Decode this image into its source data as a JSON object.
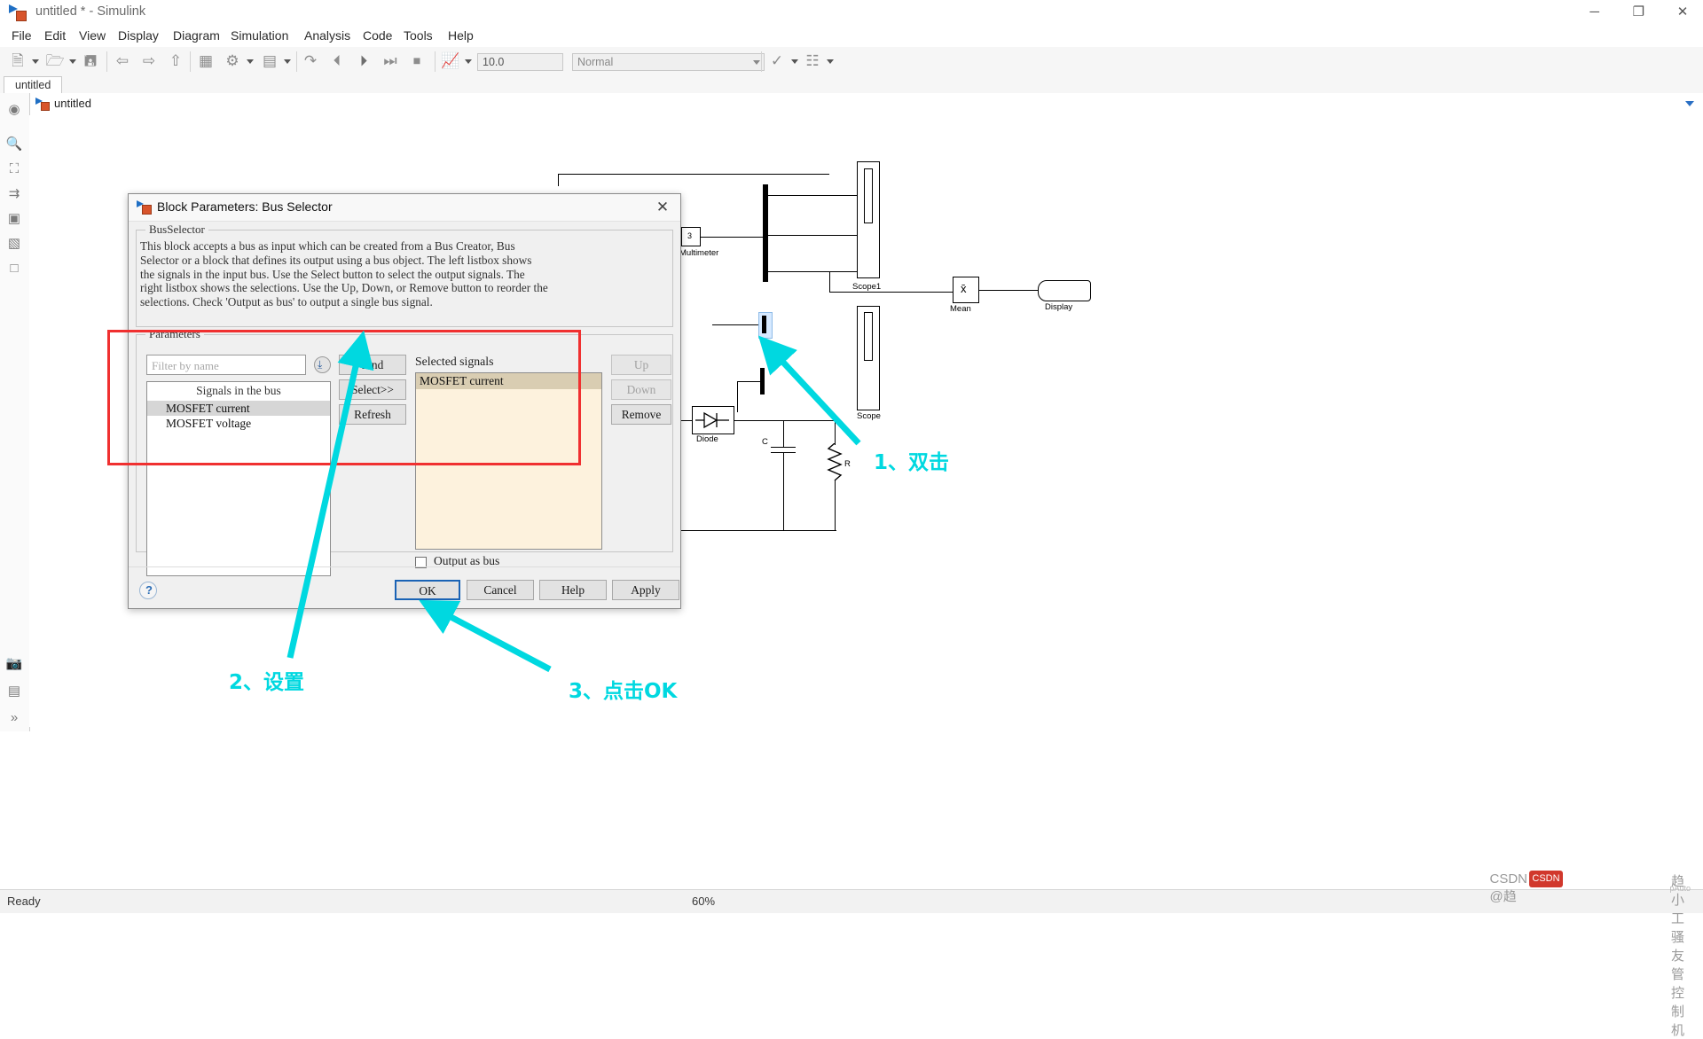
{
  "window": {
    "title": "untitled * - Simulink",
    "minimize": "─",
    "maximize": "❐",
    "close": "✕"
  },
  "menu": {
    "items": [
      "File",
      "Edit",
      "View",
      "Display",
      "Diagram",
      "Simulation",
      "Analysis",
      "Code",
      "Tools",
      "Help"
    ]
  },
  "toolbar": {
    "new_model_icon": "new-model-icon",
    "open_icon": "open-folder-icon",
    "save_icon": "save-icon",
    "back_icon": "back-arrow-icon",
    "forward_icon": "forward-arrow-icon",
    "up_icon": "up-arrow-icon",
    "library_icon": "library-browser-icon",
    "settings_icon": "model-configuration-icon",
    "model_explorer_icon": "model-explorer-icon",
    "update_icon": "update-model-icon",
    "build_icon": "build-model-icon",
    "run_icon": "run-icon",
    "step_icon": "step-forward-icon",
    "stop_icon": "stop-icon",
    "scope_icon": "simulation-data-inspector-icon",
    "stop_time_value": "10.0",
    "sim_mode_value": "Normal",
    "check_icon": "model-advisor-icon",
    "perspective_icon": "perspectives-icon"
  },
  "model_tab": {
    "label": "untitled"
  },
  "breadcrumb": {
    "label": "untitled"
  },
  "rail": {
    "items": [
      "navigate-icon",
      "zoom-icon",
      "fit-to-view-icon",
      "pan-icon",
      "annotation-icon",
      "image-icon",
      "area-icon",
      "camera-icon",
      "legend-icon",
      "expand-icon"
    ]
  },
  "canvas": {
    "blocks": [
      {
        "name": "Multimeter",
        "label": "Multimeter"
      },
      {
        "name": "Scope1",
        "label": "Scope1"
      },
      {
        "name": "Scope",
        "label": "Scope"
      },
      {
        "name": "Mean",
        "label": "Mean"
      },
      {
        "name": "Display",
        "label": "Display"
      },
      {
        "name": "Diode",
        "label": "Diode"
      },
      {
        "name": "C",
        "label": "C"
      },
      {
        "name": "R",
        "label": "R"
      }
    ],
    "multimeter_port": "3",
    "mean_symbol": "x̄"
  },
  "dialog": {
    "title": "Block Parameters: Bus Selector",
    "close_label": "✕",
    "group_bus": "BusSelector",
    "description": "This block accepts a bus as input which can be created from a Bus Creator, Bus\nSelector or a block that defines its output using a bus object. The left listbox shows\nthe signals in the input bus. Use the Select button to select the output signals. The\nright listbox shows the selections. Use the Up, Down, or Remove button to reorder the\nselections. Check 'Output as bus' to output a single bus signal.",
    "group_parameters": "Parameters",
    "filter_placeholder": "Filter by name",
    "filter_value": "",
    "filter_options_icon": "filter-options-icon",
    "signals_header": "Signals in the bus",
    "signals": [
      {
        "label": "MOSFET current",
        "selected": true
      },
      {
        "label": "MOSFET voltage",
        "selected": false
      }
    ],
    "find_label": "Find",
    "select_label": "Select>>",
    "refresh_label": "Refresh",
    "selected_signals_label": "Selected signals",
    "selected_signals": [
      {
        "label": "MOSFET current",
        "selected": true
      }
    ],
    "up_label": "Up",
    "down_label": "Down",
    "remove_label": "Remove",
    "output_as_bus_label": "Output as bus",
    "output_as_bus_checked": false,
    "ok_label": "OK",
    "cancel_label": "Cancel",
    "help_label": "Help",
    "apply_label": "Apply",
    "help_icon": "help-question-icon"
  },
  "annotations": {
    "step1": "1、双击",
    "step2": "2、设置",
    "step3": "3、点击OK",
    "highlight_color": "#f03030",
    "arrow_color": "#00d8e0"
  },
  "statusbar": {
    "ready": "Ready",
    "zoom": "60%"
  },
  "watermark": {
    "prefix": "CSDN @趋",
    "logo": "CSDN",
    "name": "趋小工骚友管控制机",
    "sub": "pAuto"
  }
}
